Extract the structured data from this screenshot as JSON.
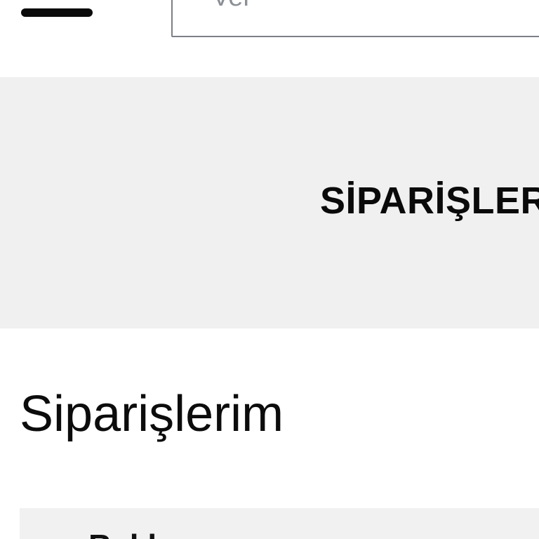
{
  "header": {
    "menu_icon": "hamburger-menu-icon",
    "search": {
      "value": "",
      "placeholder": "Ver"
    }
  },
  "banner": {
    "title": "SİPARİŞLER"
  },
  "main": {
    "title": "Siparişlerim",
    "order_card": {
      "label": "Bekleyen"
    }
  },
  "colors": {
    "background": "#ffffff",
    "banner_background": "#f0f0f0",
    "card_background": "#f1f1f1",
    "search_border": "#7b7f88",
    "placeholder_text": "#8b8f96",
    "text": "#0a0a0a"
  }
}
